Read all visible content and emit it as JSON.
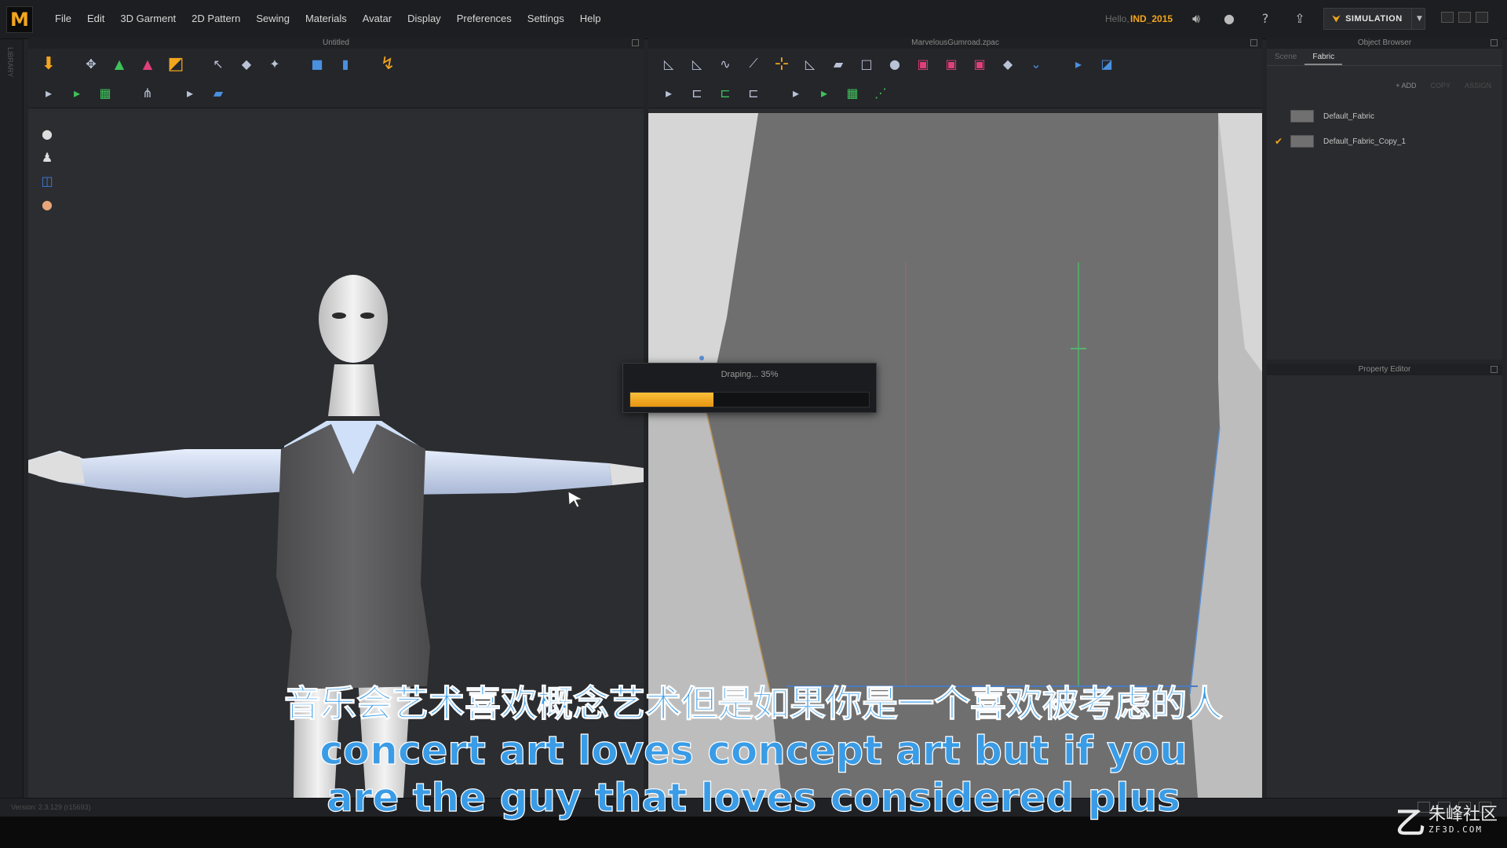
{
  "menubar": {
    "logo": "M",
    "items": [
      "File",
      "Edit",
      "3D Garment",
      "2D Pattern",
      "Sewing",
      "Materials",
      "Avatar",
      "Display",
      "Preferences",
      "Settings",
      "Help"
    ],
    "hello": "Hello,",
    "user": "IND_2015",
    "simulation_label": "SIMULATION"
  },
  "leftstrip": {
    "label": "LIBRARY"
  },
  "window3d": {
    "title": "Untitled"
  },
  "window2d": {
    "title": "MarvelousGumroad.zpac"
  },
  "object_browser": {
    "title": "Object Browser",
    "tabs": [
      "Scene",
      "Fabric"
    ],
    "active_tab": "Fabric",
    "actions": {
      "add": "+ ADD",
      "copy": "COPY",
      "assign": "ASSIGN"
    },
    "fabrics": [
      {
        "name": "Default_Fabric",
        "checked": false,
        "swatch": "#707070"
      },
      {
        "name": "Default_Fabric_Copy_1",
        "checked": true,
        "swatch": "#707070"
      }
    ]
  },
  "property_editor": {
    "title": "Property Editor"
  },
  "progress": {
    "text": "Draping... 35%",
    "value": 0.35
  },
  "status": {
    "version": "Version: 2.3.129    (r15693)"
  },
  "subtitles": {
    "zh": "音乐会艺术喜欢概念艺术但是如果你是一个喜欢被考虑的人",
    "en_line1": "concert art loves concept art but if you",
    "en_line2": "are the guy that loves considered plus"
  },
  "watermark": {
    "cn": "朱峰社区",
    "en": "ZF3D.COM"
  },
  "colors": {
    "accent": "#f2a51e",
    "subtitle": "#3a9ce6",
    "pattern_bg": "#bdbdbd",
    "pattern_piece": "#6f6f6f"
  }
}
